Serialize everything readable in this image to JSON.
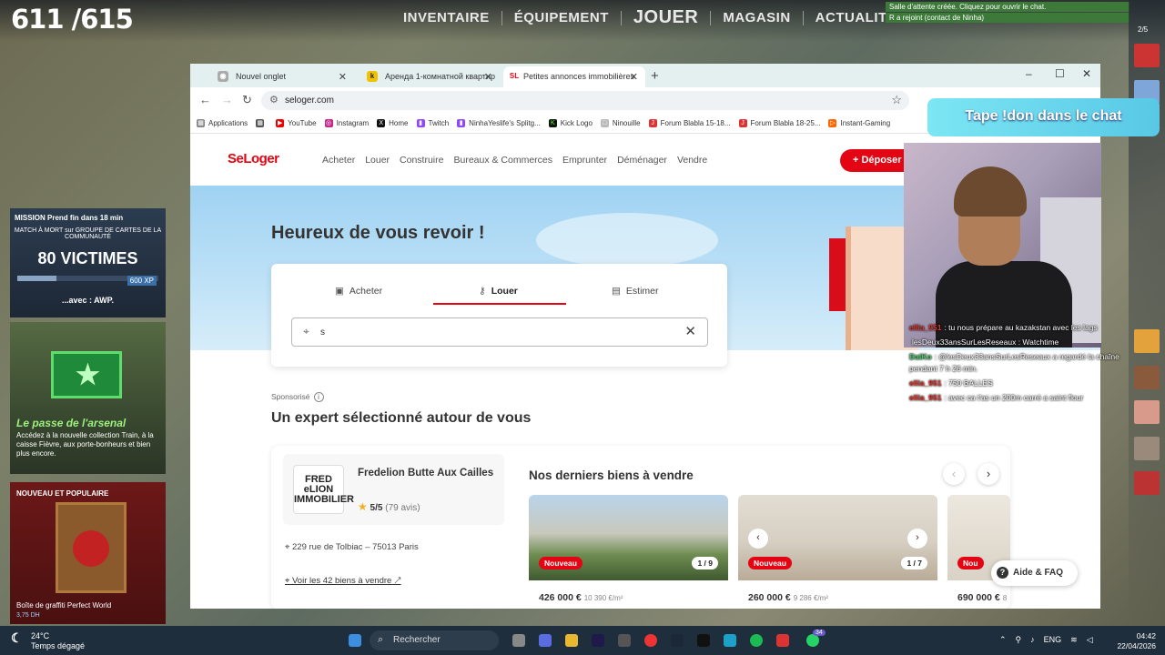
{
  "game": {
    "score": "611 /615",
    "nav": [
      "INVENTAIRE",
      "ÉQUIPEMENT",
      "JOUER",
      "MAGASIN",
      "ACTUALITÉS"
    ],
    "notifications": [
      "Salle d'attente créée. Cliquez pour ouvrir le chat.",
      "R a rejoint (contact de Ninha)"
    ],
    "friends_count": "2/5",
    "mission": {
      "header": "MISSION Prend fin dans 18 min",
      "subtitle": "MATCH À MORT sur GROUPE DE CARTES DE LA COMMUNAUTÉ",
      "goal": "80 VICTIMES",
      "xp": "600 XP",
      "weapon": "...avec : AWP."
    },
    "arsenal": {
      "title": "Le passe de l'arsenal",
      "desc": "Accédez à la nouvelle collection Train, à la caisse Fièvre, aux porte-bonheurs et bien plus encore."
    },
    "graffiti": {
      "header": "NOUVEAU ET POPULAIRE",
      "name": "Boîte de graffiti Perfect World",
      "price": "3,75 DH"
    }
  },
  "browser": {
    "tabs": [
      {
        "title": "Nouvel onglet",
        "icon": "chrome-icon"
      },
      {
        "title": "Аренда 1-комнатной квартир",
        "icon": "k-icon"
      },
      {
        "title": "Petites annonces immobilières",
        "icon": "seloger-icon"
      }
    ],
    "url": "seloger.com",
    "bookmarks": [
      "Applications",
      "YouTube",
      "Instagram",
      "Home",
      "Twitch",
      "NinhaYeslife's Splitg...",
      "Kick Logo",
      "Ninouille",
      "Forum Blabla 15-18...",
      "Forum Blabla 18-25...",
      "Instant-Gaming"
    ]
  },
  "site": {
    "logo": "SeLoger",
    "nav": [
      "Acheter",
      "Louer",
      "Construire",
      "Bureaux & Commerces",
      "Emprunter",
      "Déménager",
      "Vendre"
    ],
    "deposer": "Déposer",
    "welcome": "Heureux de vous revoir !",
    "search_tabs": [
      "Acheter",
      "Louer",
      "Estimer"
    ],
    "search_value": "s",
    "sponsored": "Sponsorisé",
    "expert_title": "Un expert sélectionné autour de vous",
    "agency": {
      "logo": "FRED eLION IMMOBILIER",
      "name": "Fredelion Butte Aux Cailles",
      "rating": "5/5",
      "reviews": "(79 avis)",
      "address": "229 rue de Tolbiac – 75013 Paris",
      "link": "Voir les 42 biens à vendre"
    },
    "listings_title": "Nos derniers biens à vendre",
    "listings": [
      {
        "badge": "Nouveau",
        "count": "1 / 9",
        "price": "426 000 €",
        "sqm": "10 390 €/m²"
      },
      {
        "badge": "Nouveau",
        "count": "1 / 7",
        "price": "260 000 €",
        "sqm": "9 286 €/m²"
      },
      {
        "badge": "Nou",
        "count": "",
        "price": "690 000 €",
        "sqm": "8"
      }
    ],
    "aide": "Aide & FAQ"
  },
  "stream": {
    "tape_don": "Tape !don dans le chat",
    "chat": [
      {
        "user": "ellia_951",
        "msg": ": tu nous prépare au kazakstan avec les lags",
        "color": "red"
      },
      {
        "user": "",
        "msg": "lesDeux33ansSurLesReseaux : Watchtime",
        "color": "red"
      },
      {
        "user": "DaiKo",
        "msg": ": @lesDeux33ansSurLesReseaux a regardé la chaîne pendant 7 h 26 min.",
        "color": "green"
      },
      {
        "user": "ellia_951",
        "msg": ": 750 BALLES",
        "color": "red"
      },
      {
        "user": "ellia_951",
        "msg": ": avec ca t'as un 200m carré a saint flour",
        "color": "red"
      }
    ]
  },
  "taskbar": {
    "temp": "24°C",
    "weather": "Temps dégagé",
    "search": "Rechercher",
    "lang": "ENG",
    "time": "04:42",
    "date": "22/04/2026",
    "badge": "34"
  }
}
